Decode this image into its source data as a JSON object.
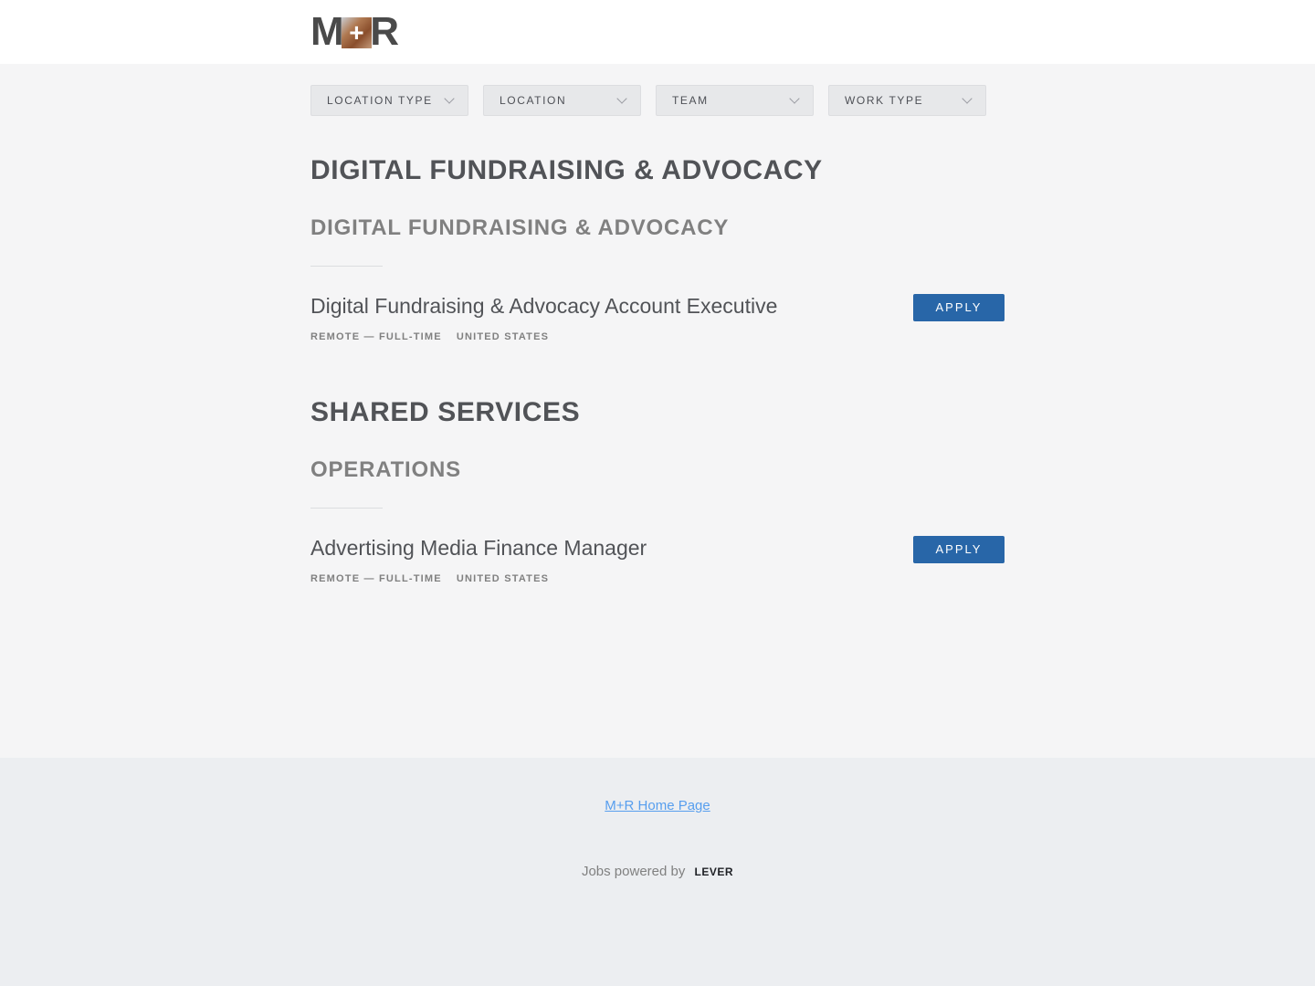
{
  "header": {
    "logo_text_left": "M",
    "logo_text_plus": "+",
    "logo_text_right": "R",
    "logo_alt": "M+R"
  },
  "filters": [
    {
      "label": "LOCATION TYPE"
    },
    {
      "label": "LOCATION"
    },
    {
      "label": "TEAM"
    },
    {
      "label": "WORK TYPE"
    }
  ],
  "departments": [
    {
      "title": "DIGITAL FUNDRAISING & ADVOCACY",
      "team": "DIGITAL FUNDRAISING & ADVOCACY",
      "job": {
        "title": "Digital Fundraising & Advocacy Account Executive",
        "commitment": "REMOTE — FULL-TIME",
        "location": "UNITED STATES",
        "apply_label": "APPLY"
      }
    },
    {
      "title": "SHARED SERVICES",
      "team": "OPERATIONS",
      "job": {
        "title": "Advertising Media Finance Manager",
        "commitment": "REMOTE — FULL-TIME",
        "location": "UNITED STATES",
        "apply_label": "APPLY"
      }
    }
  ],
  "footer": {
    "home_link": "M+R Home Page",
    "powered_by": "Jobs powered by",
    "lever": "LEVER"
  },
  "colors": {
    "accent": "#2866a8",
    "link": "#579eee",
    "background": "#f5f5f6"
  }
}
